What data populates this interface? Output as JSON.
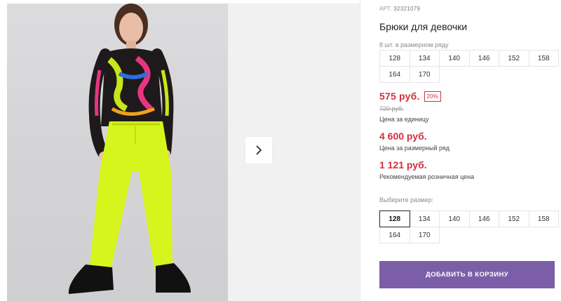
{
  "product": {
    "sku_label": "АРТ.",
    "sku_value": "32321079",
    "title": "Брюки для девочки",
    "pack_note": "8 шт. в размерном ряду",
    "pack_sizes": [
      "128",
      "134",
      "140",
      "146",
      "152",
      "158",
      "164",
      "170"
    ],
    "price": "575 руб.",
    "discount": "20%",
    "old_price": "720 руб.",
    "price_caption": "Цена за единицу",
    "pack_price": "4 600 руб.",
    "pack_price_caption": "Цена за размерный ряд",
    "retail_price": "1 121 руб.",
    "retail_price_caption": "Рекомендуемая розничная цена",
    "choose_size_label": "Выберите размер:",
    "sizes": [
      "128",
      "134",
      "140",
      "146",
      "152",
      "158",
      "164",
      "170"
    ],
    "selected_size": "128",
    "add_to_cart_label": "ДОБАВИТЬ В КОРЗИНУ"
  },
  "gallery": {
    "next_icon": "chevron-right-icon"
  },
  "colors": {
    "price_red": "#d32f3d",
    "button_purple": "#7b5ea7",
    "pants_neon": "#d6f51c"
  }
}
